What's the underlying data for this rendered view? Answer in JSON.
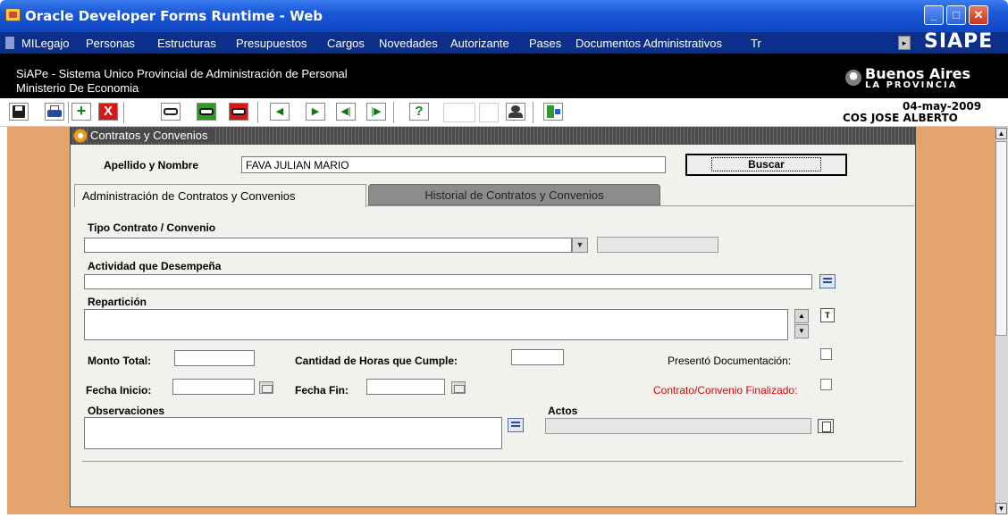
{
  "window": {
    "title": "Oracle Developer Forms Runtime - Web",
    "buttons": {
      "minimize": "_",
      "maximize": "□",
      "close": "✕"
    }
  },
  "menu": {
    "items": [
      "MILegajo",
      "Personas",
      "Estructuras",
      "Presupuestos",
      "Cargos",
      "Novedades",
      "Autorizante",
      "Pases",
      "Documentos Administrativos",
      "Tr"
    ],
    "scroll_arrow": "▸",
    "brand": "SIAPE"
  },
  "banner": {
    "line1": "SiAPe - Sistema Unico Provincial de Administración de Personal",
    "line2": "Ministerio De Economia",
    "logo_main": "Buenos Aires",
    "logo_sub": "LA PROVINCIA"
  },
  "header": {
    "date": "04-may-2009",
    "user": "COS JOSE ALBERTO"
  },
  "toolbar": {
    "add": "+",
    "delete": "X",
    "first": "◀",
    "next": "▶",
    "prev_set": "◀|",
    "last": "|▶",
    "help": "?"
  },
  "form": {
    "title": "Contratos y Convenios",
    "apellido_label": "Apellido y Nombre",
    "apellido_value": "FAVA JULIAN MARIO",
    "buscar_label": "Buscar",
    "tabs": [
      {
        "label": "Administración de Contratos y Convenios",
        "active": true
      },
      {
        "label": "Historial de Contratos y Convenios",
        "active": false
      }
    ],
    "tipo_label": "Tipo Contrato / Convenio",
    "tipo_value": "",
    "tipo_code": "",
    "actividad_label": "Actividad que Desempeña",
    "actividad_value": "",
    "reparticion_label": "Repartición",
    "reparticion_value": "",
    "monto_label": "Monto Total:",
    "monto_value": "",
    "horas_label": "Cantidad de Horas que Cumple:",
    "horas_value": "",
    "presento_label": "Presentó Documentación:",
    "presento_checked": false,
    "fecha_inicio_label": "Fecha Inicio:",
    "fecha_inicio_value": "",
    "fecha_fin_label": "Fecha Fin:",
    "fecha_fin_value": "",
    "finalizado_label": "Contrato/Convenio Finalizado:",
    "finalizado_checked": false,
    "observaciones_label": "Observaciones",
    "observaciones_value": "",
    "actos_label": "Actos",
    "actos_value": ""
  },
  "colors": {
    "titlebar": "#1a58d6",
    "menubar": "#0b2f8a",
    "workspace": "#e5a46e",
    "finalizado_label": "#e10000"
  }
}
